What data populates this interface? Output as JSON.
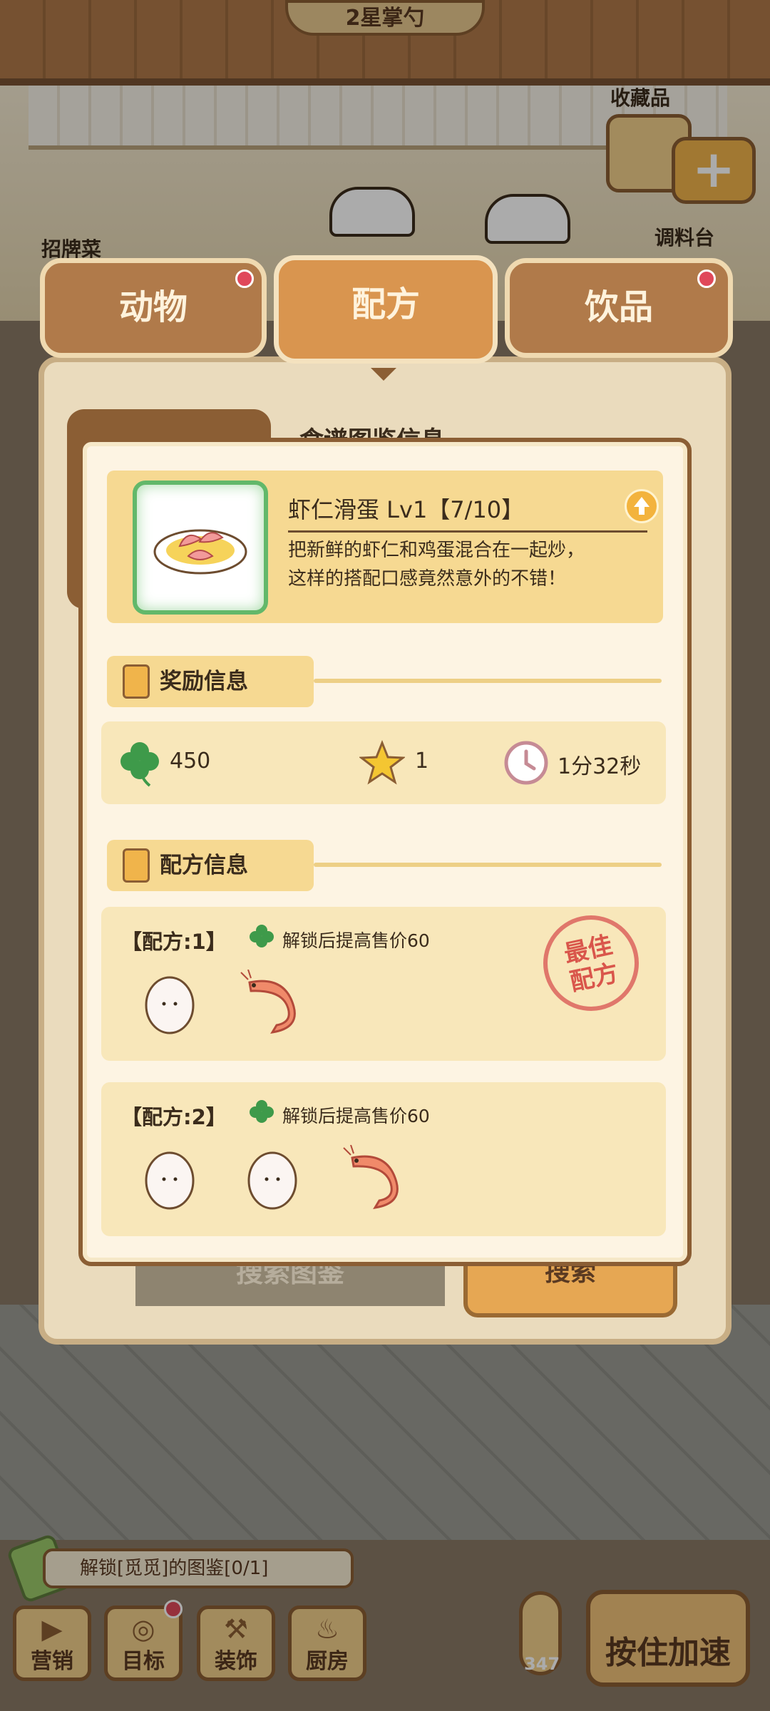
{
  "scene": {
    "stall_title": "2星掌勺",
    "signature_label": "招牌菜",
    "collection_label": "收藏品",
    "seasoning_label": "调料台"
  },
  "tabs": [
    {
      "label": "动物",
      "active": false,
      "badge": true
    },
    {
      "label": "配方",
      "active": true,
      "badge": false
    },
    {
      "label": "饮品",
      "active": false,
      "badge": true
    }
  ],
  "back_panel": {
    "title": "食谱图鉴信息",
    "search_placeholder": "搜索图鉴",
    "search_button": "搜索"
  },
  "dialog": {
    "dish": {
      "name": "虾仁滑蛋 Lv1【7/10】",
      "description_line1": "把新鲜的虾仁和鸡蛋混合在一起炒，",
      "description_line2": "这样的搭配口感竟然意外的不错！",
      "icon": "shrimp-egg-dish-icon"
    },
    "reward_section": {
      "title": "奖励信息",
      "clover": "450",
      "stars": "1",
      "time": "1分32秒"
    },
    "recipe_section": {
      "title": "配方信息",
      "recipes": [
        {
          "label": "【配方:1】",
          "bonus": "解锁后提高售价60",
          "ingredients": [
            "egg",
            "shrimp"
          ],
          "best": true
        },
        {
          "label": "【配方:2】",
          "bonus": "解锁后提高售价60",
          "ingredients": [
            "egg",
            "egg",
            "shrimp"
          ],
          "best": false
        }
      ],
      "best_stamp_line1": "最佳",
      "best_stamp_line2": "配方"
    }
  },
  "bottom": {
    "quest_text": "解锁[觅觅]的图鉴[0/1]",
    "buttons": [
      {
        "label": "营销",
        "icon": "megaphone-icon"
      },
      {
        "label": "目标",
        "icon": "target-icon",
        "badge": true
      },
      {
        "label": "装饰",
        "icon": "hammer-icon"
      },
      {
        "label": "厨房",
        "icon": "wok-icon"
      }
    ],
    "temperature": "347",
    "speed_button": "按住加速"
  },
  "colors": {
    "accent": "#d9954f",
    "panel": "#fdf4e3",
    "highlight": "#f6d992",
    "badge": "#e0485a",
    "clover": "#3e9a4a"
  }
}
